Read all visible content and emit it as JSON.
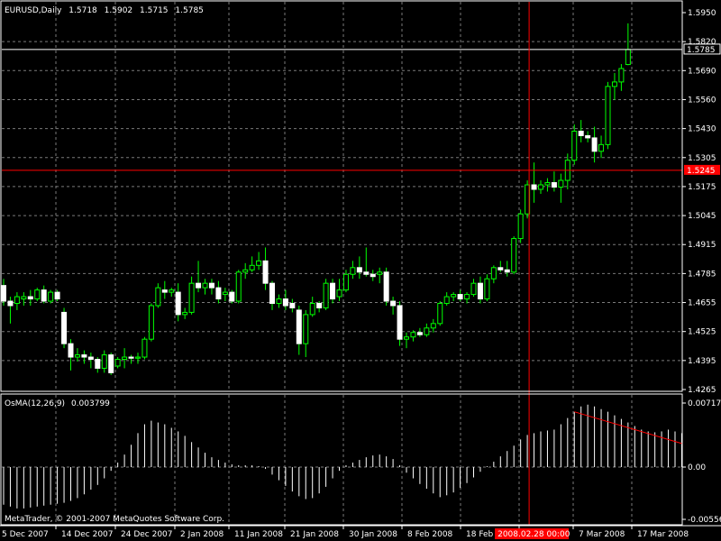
{
  "colors": {
    "background": "#000000",
    "grid": "#7a7a7a",
    "bull": "#ffffff",
    "bear": "#ffffff",
    "wick": "#00ff00",
    "crosshair": "#ff0000",
    "price_line": "#ffffff",
    "osma_bars": "#ffffff",
    "trendline": "#ff0000",
    "text": "#ffffff"
  },
  "header": {
    "symbol_label": "EURUSD,Daily",
    "open": "1.5718",
    "high": "1.5902",
    "low": "1.5715",
    "close": "1.5785"
  },
  "indicator": {
    "label": "OsMA(12,26,9)",
    "value": "0.003799"
  },
  "copyright": "MetaTrader, © 2001-2007 MetaQuotes Software Corp.",
  "price_axis": {
    "ticks": [
      "1.5950",
      "1.5820",
      "1.5690",
      "1.5560",
      "1.5430",
      "1.5305",
      "1.5175",
      "1.5045",
      "1.4915",
      "1.4785",
      "1.4655",
      "1.4525",
      "1.4395",
      "1.4265"
    ],
    "current_price_label": "1.5785",
    "crosshair_price_label": "1.5245"
  },
  "indicator_axis": {
    "ticks": [
      "0.007179",
      "0.00",
      "-0.00556"
    ]
  },
  "time_axis": {
    "ticks": [
      "5 Dec 2007",
      "14 Dec 2007",
      "24 Dec 2007",
      "2 Jan 2008",
      "11 Jan 2008",
      "21 Jan 2008",
      "30 Jan 2008",
      "8 Feb 2008",
      "18 Feb 2008",
      "7 Mar 2008",
      "17 Mar 2008"
    ],
    "crosshair_time_label": "2008.02.28 00:00"
  },
  "chart_data": {
    "type": "candlestick",
    "symbol": "EURUSD",
    "timeframe": "Daily",
    "ylim": [
      1.4265,
      1.595
    ],
    "candles": [
      {
        "o": 1.473,
        "h": 1.476,
        "l": 1.464,
        "c": 1.466
      },
      {
        "o": 1.466,
        "h": 1.468,
        "l": 1.456,
        "c": 1.464
      },
      {
        "o": 1.465,
        "h": 1.47,
        "l": 1.462,
        "c": 1.468
      },
      {
        "o": 1.467,
        "h": 1.47,
        "l": 1.464,
        "c": 1.468
      },
      {
        "o": 1.468,
        "h": 1.471,
        "l": 1.464,
        "c": 1.467
      },
      {
        "o": 1.467,
        "h": 1.472,
        "l": 1.466,
        "c": 1.471
      },
      {
        "o": 1.471,
        "h": 1.473,
        "l": 1.465,
        "c": 1.466
      },
      {
        "o": 1.466,
        "h": 1.471,
        "l": 1.465,
        "c": 1.47
      },
      {
        "o": 1.47,
        "h": 1.471,
        "l": 1.466,
        "c": 1.467
      },
      {
        "o": 1.461,
        "h": 1.463,
        "l": 1.445,
        "c": 1.447
      },
      {
        "o": 1.447,
        "h": 1.449,
        "l": 1.435,
        "c": 1.441
      },
      {
        "o": 1.441,
        "h": 1.445,
        "l": 1.439,
        "c": 1.442
      },
      {
        "o": 1.442,
        "h": 1.444,
        "l": 1.438,
        "c": 1.441
      },
      {
        "o": 1.441,
        "h": 1.443,
        "l": 1.436,
        "c": 1.44
      },
      {
        "o": 1.44,
        "h": 1.441,
        "l": 1.434,
        "c": 1.436
      },
      {
        "o": 1.436,
        "h": 1.444,
        "l": 1.434,
        "c": 1.442
      },
      {
        "o": 1.442,
        "h": 1.443,
        "l": 1.433,
        "c": 1.434
      },
      {
        "o": 1.437,
        "h": 1.441,
        "l": 1.436,
        "c": 1.44
      },
      {
        "o": 1.44,
        "h": 1.445,
        "l": 1.436,
        "c": 1.441
      },
      {
        "o": 1.441,
        "h": 1.442,
        "l": 1.438,
        "c": 1.4405
      },
      {
        "o": 1.4405,
        "h": 1.443,
        "l": 1.438,
        "c": 1.441
      },
      {
        "o": 1.441,
        "h": 1.45,
        "l": 1.44,
        "c": 1.449
      },
      {
        "o": 1.449,
        "h": 1.465,
        "l": 1.448,
        "c": 1.464
      },
      {
        "o": 1.464,
        "h": 1.474,
        "l": 1.463,
        "c": 1.472
      },
      {
        "o": 1.471,
        "h": 1.475,
        "l": 1.467,
        "c": 1.47
      },
      {
        "o": 1.47,
        "h": 1.472,
        "l": 1.468,
        "c": 1.471
      },
      {
        "o": 1.47,
        "h": 1.474,
        "l": 1.457,
        "c": 1.46
      },
      {
        "o": 1.46,
        "h": 1.463,
        "l": 1.458,
        "c": 1.461
      },
      {
        "o": 1.461,
        "h": 1.477,
        "l": 1.46,
        "c": 1.474
      },
      {
        "o": 1.474,
        "h": 1.484,
        "l": 1.47,
        "c": 1.472
      },
      {
        "o": 1.472,
        "h": 1.476,
        "l": 1.469,
        "c": 1.474
      },
      {
        "o": 1.474,
        "h": 1.476,
        "l": 1.469,
        "c": 1.472
      },
      {
        "o": 1.472,
        "h": 1.475,
        "l": 1.465,
        "c": 1.467
      },
      {
        "o": 1.469,
        "h": 1.472,
        "l": 1.466,
        "c": 1.47
      },
      {
        "o": 1.47,
        "h": 1.471,
        "l": 1.465,
        "c": 1.466
      },
      {
        "o": 1.466,
        "h": 1.48,
        "l": 1.465,
        "c": 1.479
      },
      {
        "o": 1.479,
        "h": 1.483,
        "l": 1.476,
        "c": 1.48
      },
      {
        "o": 1.48,
        "h": 1.486,
        "l": 1.479,
        "c": 1.482
      },
      {
        "o": 1.482,
        "h": 1.488,
        "l": 1.48,
        "c": 1.484
      },
      {
        "o": 1.484,
        "h": 1.49,
        "l": 1.471,
        "c": 1.474
      },
      {
        "o": 1.474,
        "h": 1.475,
        "l": 1.462,
        "c": 1.465
      },
      {
        "o": 1.465,
        "h": 1.469,
        "l": 1.463,
        "c": 1.467
      },
      {
        "o": 1.467,
        "h": 1.471,
        "l": 1.462,
        "c": 1.464
      },
      {
        "o": 1.465,
        "h": 1.467,
        "l": 1.461,
        "c": 1.463
      },
      {
        "o": 1.462,
        "h": 1.464,
        "l": 1.442,
        "c": 1.447
      },
      {
        "o": 1.447,
        "h": 1.462,
        "l": 1.441,
        "c": 1.46
      },
      {
        "o": 1.46,
        "h": 1.468,
        "l": 1.459,
        "c": 1.465
      },
      {
        "o": 1.465,
        "h": 1.466,
        "l": 1.461,
        "c": 1.463
      },
      {
        "o": 1.463,
        "h": 1.476,
        "l": 1.462,
        "c": 1.474
      },
      {
        "o": 1.474,
        "h": 1.476,
        "l": 1.465,
        "c": 1.467
      },
      {
        "o": 1.468,
        "h": 1.476,
        "l": 1.466,
        "c": 1.471
      },
      {
        "o": 1.471,
        "h": 1.48,
        "l": 1.47,
        "c": 1.478
      },
      {
        "o": 1.478,
        "h": 1.484,
        "l": 1.476,
        "c": 1.481
      },
      {
        "o": 1.481,
        "h": 1.486,
        "l": 1.476,
        "c": 1.479
      },
      {
        "o": 1.479,
        "h": 1.49,
        "l": 1.477,
        "c": 1.478
      },
      {
        "o": 1.478,
        "h": 1.48,
        "l": 1.475,
        "c": 1.477
      },
      {
        "o": 1.478,
        "h": 1.481,
        "l": 1.474,
        "c": 1.479
      },
      {
        "o": 1.479,
        "h": 1.481,
        "l": 1.464,
        "c": 1.466
      },
      {
        "o": 1.466,
        "h": 1.468,
        "l": 1.46,
        "c": 1.464
      },
      {
        "o": 1.464,
        "h": 1.466,
        "l": 1.446,
        "c": 1.449
      },
      {
        "o": 1.449,
        "h": 1.452,
        "l": 1.445,
        "c": 1.45
      },
      {
        "o": 1.45,
        "h": 1.453,
        "l": 1.448,
        "c": 1.452
      },
      {
        "o": 1.452,
        "h": 1.454,
        "l": 1.45,
        "c": 1.451
      },
      {
        "o": 1.451,
        "h": 1.456,
        "l": 1.45,
        "c": 1.454
      },
      {
        "o": 1.454,
        "h": 1.458,
        "l": 1.452,
        "c": 1.456
      },
      {
        "o": 1.456,
        "h": 1.466,
        "l": 1.455,
        "c": 1.465
      },
      {
        "o": 1.465,
        "h": 1.47,
        "l": 1.464,
        "c": 1.468
      },
      {
        "o": 1.468,
        "h": 1.47,
        "l": 1.466,
        "c": 1.469
      },
      {
        "o": 1.469,
        "h": 1.471,
        "l": 1.466,
        "c": 1.467
      },
      {
        "o": 1.467,
        "h": 1.47,
        "l": 1.465,
        "c": 1.469
      },
      {
        "o": 1.469,
        "h": 1.476,
        "l": 1.468,
        "c": 1.474
      },
      {
        "o": 1.474,
        "h": 1.477,
        "l": 1.465,
        "c": 1.467
      },
      {
        "o": 1.467,
        "h": 1.478,
        "l": 1.466,
        "c": 1.476
      },
      {
        "o": 1.476,
        "h": 1.482,
        "l": 1.474,
        "c": 1.481
      },
      {
        "o": 1.481,
        "h": 1.484,
        "l": 1.479,
        "c": 1.48
      },
      {
        "o": 1.48,
        "h": 1.484,
        "l": 1.477,
        "c": 1.479
      },
      {
        "o": 1.479,
        "h": 1.495,
        "l": 1.478,
        "c": 1.494
      },
      {
        "o": 1.494,
        "h": 1.507,
        "l": 1.492,
        "c": 1.505
      },
      {
        "o": 1.505,
        "h": 1.52,
        "l": 1.503,
        "c": 1.518
      },
      {
        "o": 1.518,
        "h": 1.528,
        "l": 1.51,
        "c": 1.516
      },
      {
        "o": 1.516,
        "h": 1.52,
        "l": 1.514,
        "c": 1.518
      },
      {
        "o": 1.518,
        "h": 1.521,
        "l": 1.515,
        "c": 1.519
      },
      {
        "o": 1.519,
        "h": 1.524,
        "l": 1.515,
        "c": 1.517
      },
      {
        "o": 1.517,
        "h": 1.523,
        "l": 1.51,
        "c": 1.52
      },
      {
        "o": 1.52,
        "h": 1.532,
        "l": 1.516,
        "c": 1.529
      },
      {
        "o": 1.529,
        "h": 1.545,
        "l": 1.527,
        "c": 1.542
      },
      {
        "o": 1.542,
        "h": 1.547,
        "l": 1.537,
        "c": 1.54
      },
      {
        "o": 1.54,
        "h": 1.542,
        "l": 1.537,
        "c": 1.539
      },
      {
        "o": 1.539,
        "h": 1.544,
        "l": 1.528,
        "c": 1.533
      },
      {
        "o": 1.533,
        "h": 1.54,
        "l": 1.53,
        "c": 1.536
      },
      {
        "o": 1.536,
        "h": 1.564,
        "l": 1.534,
        "c": 1.562
      },
      {
        "o": 1.562,
        "h": 1.568,
        "l": 1.556,
        "c": 1.564
      },
      {
        "o": 1.564,
        "h": 1.572,
        "l": 1.56,
        "c": 1.57
      },
      {
        "o": 1.5718,
        "h": 1.5902,
        "l": 1.5715,
        "c": 1.5785
      }
    ],
    "osma": {
      "label": "OsMA(12,26,9)",
      "ylim": [
        -0.00556,
        0.007179
      ],
      "values": [
        -0.004,
        -0.0042,
        -0.0044,
        -0.0044,
        -0.0043,
        -0.0042,
        -0.0041,
        -0.004,
        -0.0039,
        -0.0038,
        -0.0036,
        -0.0033,
        -0.0029,
        -0.0024,
        -0.0019,
        -0.0012,
        -0.0004,
        0.0005,
        0.0014,
        0.0025,
        0.0038,
        0.0048,
        0.0052,
        0.005,
        0.0048,
        0.0044,
        0.004,
        0.0035,
        0.0028,
        0.0022,
        0.0016,
        0.0011,
        0.0008,
        0.0005,
        0.0003,
        0.0002,
        0.0002,
        0.0002,
        0.0001,
        -0.0002,
        -0.0008,
        -0.0014,
        -0.002,
        -0.0026,
        -0.0031,
        -0.0034,
        -0.0033,
        -0.0028,
        -0.0021,
        -0.0012,
        -0.0004,
        0.0002,
        0.0005,
        0.0008,
        0.0011,
        0.0013,
        0.0014,
        0.0012,
        0.0009,
        0.0002,
        -0.0006,
        -0.0012,
        -0.0018,
        -0.0023,
        -0.0028,
        -0.0032,
        -0.003,
        -0.0027,
        -0.0022,
        -0.0017,
        -0.0011,
        -0.0005,
        0.0001,
        0.0006,
        0.0012,
        0.0018,
        0.0024,
        0.0031,
        0.0036,
        0.0038,
        0.004,
        0.0041,
        0.0042,
        0.0048,
        0.0055,
        0.0062,
        0.0068,
        0.007,
        0.0068,
        0.0065,
        0.0062,
        0.0058,
        0.0054,
        0.005,
        0.0046,
        0.0042,
        0.004,
        0.0039,
        0.004,
        0.0042,
        0.004,
        0.0038
      ]
    },
    "annotations": [
      "current price line 1.5785",
      "crosshair at 2008.02.28 00:00 / 1.5245",
      "red downward trendline on OsMA peaks"
    ]
  }
}
